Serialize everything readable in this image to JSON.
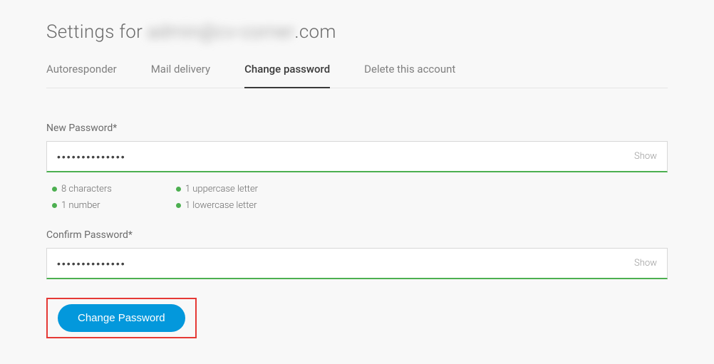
{
  "header": {
    "title_prefix": "Settings for ",
    "title_blurred": "admin@cv-corner",
    "title_suffix": ".com"
  },
  "tabs": {
    "autoresponder": "Autoresponder",
    "mail_delivery": "Mail delivery",
    "change_password": "Change password",
    "delete_account": "Delete this account"
  },
  "form": {
    "new_password_label": "New Password*",
    "new_password_value": "••••••••••••••",
    "confirm_password_label": "Confirm Password*",
    "confirm_password_value": "••••••••••••••",
    "show_toggle": "Show",
    "submit_label": "Change Password"
  },
  "requirements": {
    "chars": "8 characters",
    "number": "1 number",
    "uppercase": "1 uppercase letter",
    "lowercase": "1 lowercase letter"
  }
}
